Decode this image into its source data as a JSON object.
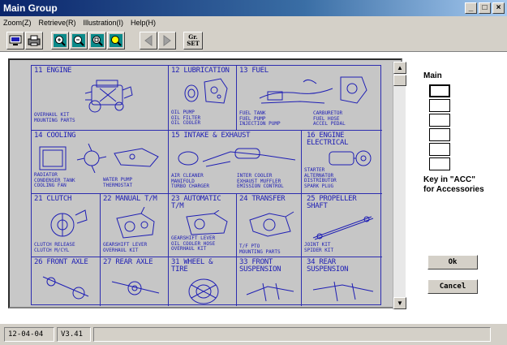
{
  "window": {
    "title": "Main Group"
  },
  "menu": [
    {
      "label": "Zoom(Z)"
    },
    {
      "label": "Retrieve(R)"
    },
    {
      "label": "Illustration(I)"
    },
    {
      "label": "Help(H)"
    }
  ],
  "toolbar": {
    "gr_set_label_1": "Gr.",
    "gr_set_label_2": "SET"
  },
  "groups": [
    {
      "title": "11 ENGINE",
      "parts": "OVERHAUL KIT\nMOUNTING PARTS"
    },
    {
      "title": "12 LUBRICATION",
      "parts": "OIL PUMP\nOIL FILTER\nOIL COOLER"
    },
    {
      "title": "13 FUEL",
      "parts": "FUEL TANK\nFUEL PUMP\nINJECTION PUMP",
      "parts2": "CARBURETOR\nFUEL HOSE\nACCEL PEDAL"
    },
    {
      "title": "14 COOLING",
      "parts": "RADIATOR\nCONDENSER TANK\nCOOLING FAN",
      "parts2": "WATER PUMP\nTHERMOSTAT"
    },
    {
      "title": "15 INTAKE & EXHAUST",
      "parts": "AIR CLEANER\nMANIFOLD\nTURBO CHARGER",
      "parts2": "INTER COOLER\nEXHAUST MUFFLER\nEMISSION CONTROL"
    },
    {
      "title": "16 ENGINE\n   ELECTRICAL",
      "parts": "STARTER\nALTERNATOR\nDISTRIBUTOR\nSPARK PLUG"
    },
    {
      "title": "21 CLUTCH",
      "parts": "CLUTCH RELEASE\nCLUTCH M/CYL"
    },
    {
      "title": "22 MANUAL T/M",
      "parts": "GEARSHIFT LEVER\nOVERHAUL KIT"
    },
    {
      "title": "23 AUTOMATIC\n   T/M",
      "parts": "GEARSHIFT LEVER\nOIL COOLER HOSE\nOVERHAUL KIT"
    },
    {
      "title": "24 TRANSFER",
      "parts": "T/F PTO\nMOUNTING PARTS"
    },
    {
      "title": "25 PROPELLER\n   SHAFT",
      "parts": "JOINT KIT\nSPIDER KIT"
    },
    {
      "title": "26 FRONT AXLE",
      "parts": ""
    },
    {
      "title": "27 REAR AXLE",
      "parts": ""
    },
    {
      "title": "31 WHEEL &\n   TIRE",
      "parts": ""
    },
    {
      "title": "33 FRONT\n   SUSPENSION",
      "parts": ""
    },
    {
      "title": "34 REAR\n   SUSPENSION",
      "parts": ""
    }
  ],
  "right_panel": {
    "title": "Main",
    "inputs": [
      "",
      "",
      "",
      "",
      "",
      ""
    ],
    "hint": "Key in \"ACC\"\nfor Accessories",
    "ok_label": "Ok",
    "cancel_label": "Cancel"
  },
  "status": {
    "date": "12-04-04",
    "version": "V3.41",
    "message": ""
  },
  "colors": {
    "line": "#1e1eb4",
    "paper": "#c6c6c6"
  }
}
